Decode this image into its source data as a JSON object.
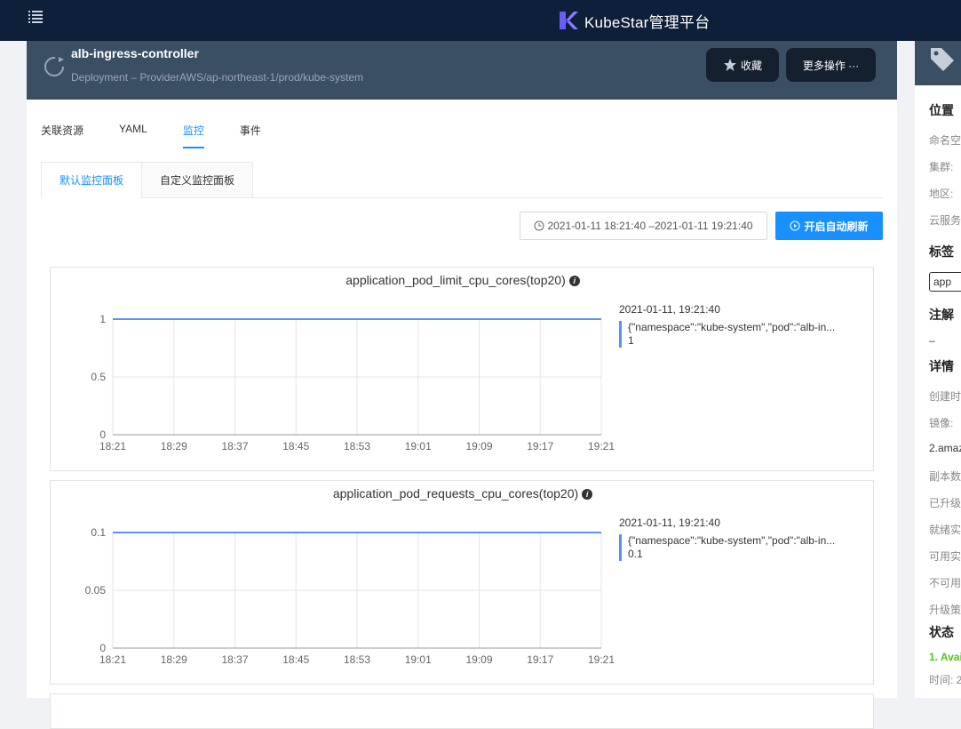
{
  "topbar": {
    "brand": "KubeStar管理平台",
    "menu_icon": "list-menu-icon",
    "logo_icon": "kubestar-logo-icon"
  },
  "header": {
    "title": "alb-ingress-controller",
    "subtitle": "Deployment – ProviderAWS/ap-northeast-1/prod/kube-system",
    "fav_label": "收藏",
    "more_label": "更多操作 ···"
  },
  "tabs": [
    {
      "label": "关联资源"
    },
    {
      "label": "YAML"
    },
    {
      "label": "监控",
      "active": true
    },
    {
      "label": "事件"
    }
  ],
  "subtabs": [
    {
      "label": "默认监控面板",
      "active": true
    },
    {
      "label": "自定义监控面板"
    }
  ],
  "toolbar": {
    "time_range": "2021-01-11 18:21:40 –2021-01-11 19:21:40",
    "refresh_label": "开启自动刷新"
  },
  "colors": {
    "accent": "#1890ff",
    "series": "#5b8ff9",
    "header_bg": "#3a4e64",
    "topbar_bg": "#0e1f39"
  },
  "chart_data": [
    {
      "type": "line",
      "title": "application_pod_limit_cpu_cores(top20)",
      "x": [
        "18:21",
        "18:29",
        "18:37",
        "18:45",
        "18:53",
        "19:01",
        "19:09",
        "19:17",
        "19:21"
      ],
      "yticks": [
        "0",
        "0.5",
        "1"
      ],
      "ylim": [
        0,
        1
      ],
      "series": [
        {
          "name": "{\"namespace\":\"kube-system\",\"pod\":\"alb-in...",
          "values": [
            1,
            1,
            1,
            1,
            1,
            1,
            1,
            1,
            1
          ]
        }
      ],
      "legend": {
        "time": "2021-01-11, 19:21:40",
        "value": "1"
      },
      "grid": true
    },
    {
      "type": "line",
      "title": "application_pod_requests_cpu_cores(top20)",
      "x": [
        "18:21",
        "18:29",
        "18:37",
        "18:45",
        "18:53",
        "19:01",
        "19:09",
        "19:17",
        "19:21"
      ],
      "yticks": [
        "0",
        "0.05",
        "0.1"
      ],
      "ylim": [
        0,
        0.1
      ],
      "series": [
        {
          "name": "{\"namespace\":\"kube-system\",\"pod\":\"alb-in...",
          "values": [
            0.1,
            0.1,
            0.1,
            0.1,
            0.1,
            0.1,
            0.1,
            0.1,
            0.1
          ]
        }
      ],
      "legend": {
        "time": "2021-01-11, 19:21:40",
        "value": "0.1"
      },
      "grid": true
    }
  ],
  "side": {
    "location": "位置",
    "namespace": "命名空",
    "cluster": "集群:",
    "region": "地区:",
    "provider": "云服务",
    "labels": "标签",
    "tag": "app",
    "annotations": "注解",
    "annotations_value": "–",
    "details": "详情",
    "created": "创建时",
    "image": "镜像:",
    "image_value": "2.amaz",
    "replicas": "副本数",
    "upgraded": "已升级",
    "ready": "就绪实",
    "available": "可用实",
    "unavailable": "不可用",
    "strategy": "升级策",
    "status": "状态",
    "status_value": "1. Avai",
    "time": "时间: 2"
  }
}
